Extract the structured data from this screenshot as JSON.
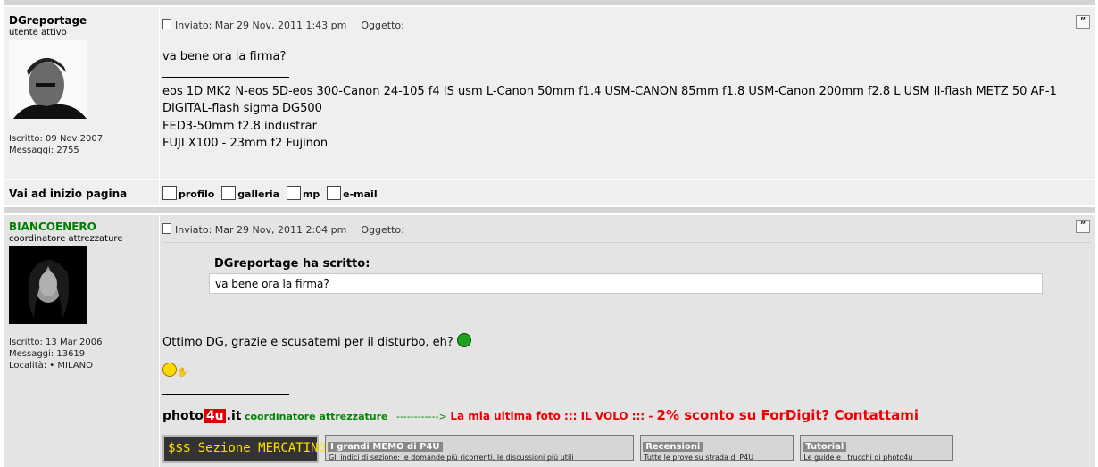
{
  "posts": [
    {
      "author": "DGreportage",
      "rank": "utente attivo",
      "stats": [
        "Iscritto: 09 Nov 2007",
        "Messaggi: 2755"
      ],
      "header": {
        "sent": "Inviato: Mar 29 Nov, 2011 1:43 pm",
        "subject": "Oggetto:"
      },
      "quote_icon": "”",
      "body": [
        "va bene ora la firma?"
      ],
      "signature": [
        "eos 1D MK2 N-eos 5D-eos 300-Canon 24-105 f4 IS usm L-Canon 50mm f1.4 USM-CANON 85mm f1.8 USM-Canon 200mm f2.8 L USM II-flash METZ 50 AF-1",
        "DIGITAL-flash sigma DG500",
        "FED3-50mm f2.8 industrar",
        "FUJI X100 - 23mm f2 Fujinon"
      ]
    },
    {
      "author": "BIANCOENERO",
      "author_color": "#008000",
      "rank": "coordinatore attrezzature",
      "stats": [
        "Iscritto: 13 Mar 2006",
        "Messaggi: 13619",
        "Località: • MILANO"
      ],
      "header": {
        "sent": "Inviato: Mar 29 Nov, 2011 2:04 pm",
        "subject": "Oggetto:"
      },
      "quote_icon": "”",
      "quote_author": "DGreportage ha scritto:",
      "quote_text": "va bene ora la firma?",
      "body": [
        "Ottimo DG, grazie e scusatemi per il disturbo, eh?"
      ],
      "signature": {
        "logo_a": "photo",
        "logo_b": "4u",
        "logo_c": ".it",
        "role": "coordinatore attrezzature",
        "arrow": "------------>",
        "photo_link": "La mia ultima foto ::: IL VOLO :::",
        "dash": " - ",
        "promo": "2% sconto su ForDigit? Contattami"
      },
      "banners": [
        {
          "title": "$$$ Sezione MERCATINO"
        },
        {
          "title": "I grandi MEMO di P4U",
          "sub": "Gli indici di sezione: le domande più ricorrenti, le discussioni più utili"
        },
        {
          "title": "Recensioni",
          "sub": "Tutte le prove su strada di P4U"
        },
        {
          "title": "Tutorial",
          "sub": "Le guide e i trucchi di photo4u"
        }
      ]
    }
  ],
  "back_to_top": "Vai ad inizio pagina",
  "tools": [
    "profilo",
    "galleria",
    "mp",
    "e-mail"
  ],
  "icons": [
    "document-icon",
    "quote-icon",
    "profile-icon",
    "gallery-icon",
    "pm-icon",
    "email-icon",
    "smiley-icon",
    "green-smiley-icon"
  ]
}
